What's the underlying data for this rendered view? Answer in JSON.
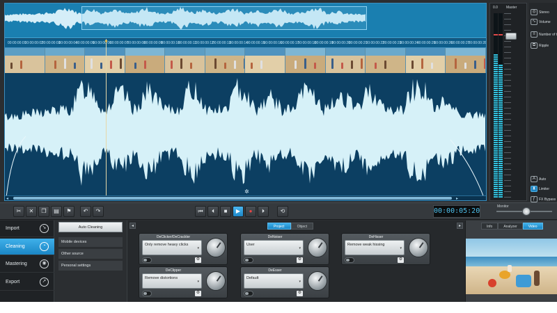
{
  "editor": {
    "timeline_labels": [
      "00:00:00:01",
      "00:00:00:02",
      "00:00:00:03",
      "00:00:00:04",
      "00:00:00:05",
      "00:00:00:06",
      "00:00:00:07",
      "00:00:00:08",
      "00:00:00:09",
      "00:00:00:10",
      "00:00:00:11",
      "00:00:00:12",
      "00:00:00:13",
      "00:00:00:14",
      "00:00:00:15",
      "00:00:00:16",
      "00:00:00:17",
      "00:00:00:18",
      "00:00:00:19",
      "00:00:00:20",
      "00:00:00:21",
      "00:00:00:22",
      "00:00:00:23",
      "00:00:00:24",
      "00:00:00:25",
      "00:00:00:26",
      "00:00:00:27",
      "00:00:00:28"
    ],
    "film_frames": 12
  },
  "meter": {
    "value_label": "0.0",
    "master_label": "Master",
    "level_left": 0.78,
    "level_right": 0.72
  },
  "side_options": [
    {
      "label": "Stereo",
      "icon": "stereo-icon"
    },
    {
      "label": "Volume",
      "icon": "volume-curve-icon"
    },
    {
      "label": "Number of tracks",
      "icon": "tracks-icon"
    },
    {
      "label": "Ripple",
      "icon": "ripple-icon"
    },
    {
      "label": "Auto",
      "icon": "auto-icon"
    },
    {
      "label": "Limiter",
      "icon": "limiter-icon"
    },
    {
      "label": "FX Bypass",
      "icon": "fx-bypass-icon"
    }
  ],
  "transport": {
    "edit_tools": [
      "cut-icon",
      "delete-icon",
      "copy-icon",
      "paste-icon",
      "marker-icon",
      "undo-icon",
      "redo-icon"
    ],
    "playback": [
      "skip-start-icon",
      "prev-icon",
      "stop-icon",
      "play-icon",
      "record-icon",
      "next-icon"
    ],
    "loop": "loop-icon",
    "timecode": "00:00:05:20",
    "monitor_label": "Monitor"
  },
  "nav": [
    {
      "label": "Import",
      "icon": "import-icon",
      "active": false
    },
    {
      "label": "Cleaning",
      "icon": "cleaning-icon",
      "active": true
    },
    {
      "label": "Mastering",
      "icon": "mastering-icon",
      "active": false
    },
    {
      "label": "Export",
      "icon": "export-icon",
      "active": false
    }
  ],
  "sub_nav": [
    {
      "label": "Auto Cleaning",
      "active": true
    },
    {
      "label": "Mobile devices",
      "active": false
    },
    {
      "label": "Other source",
      "active": false
    },
    {
      "label": "Personal settings",
      "active": false
    }
  ],
  "tabs": {
    "project": "Project",
    "object": "Object"
  },
  "effects": [
    {
      "title": "DeClicker/DeCrackler",
      "preset": "Only remove heavy clicks"
    },
    {
      "title": "DeNoiser",
      "preset": "User"
    },
    {
      "title": "DeHisser",
      "preset": "Remove weak hissing"
    },
    {
      "title": "DeClipper",
      "preset": "Remove distortions"
    },
    {
      "title": "DeEsser",
      "preset": "Default"
    }
  ],
  "right_tabs": [
    {
      "label": "Info",
      "active": false
    },
    {
      "label": "Analyzer",
      "active": false
    },
    {
      "label": "Video",
      "active": true
    }
  ],
  "colors": {
    "accent": "#1b86c5",
    "waveform": "#d6f1f8",
    "editor_bg": "#0c3f62",
    "timecode": "#4fc1ec"
  }
}
